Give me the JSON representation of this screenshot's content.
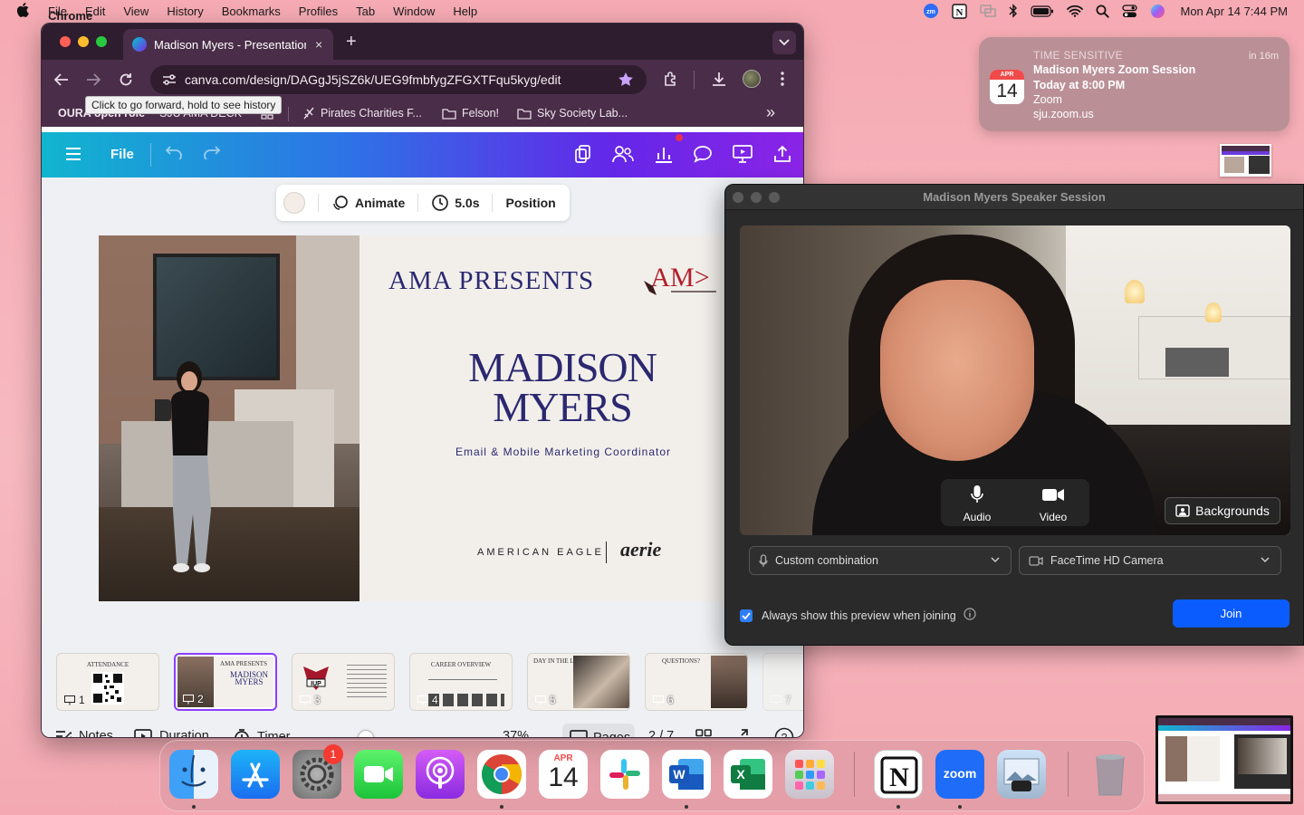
{
  "menubar": {
    "app_name": "Chrome",
    "menus": [
      "File",
      "Edit",
      "View",
      "History",
      "Bookmarks",
      "Profiles",
      "Tab",
      "Window",
      "Help"
    ],
    "clock": "Mon Apr 14  7:44 PM",
    "status_icons": [
      "zoom-icon",
      "notion-icon",
      "screen-mirror-icon",
      "bluetooth-icon",
      "battery-icon",
      "wifi-icon",
      "spotlight-search-icon",
      "control-center-icon",
      "siri-icon"
    ]
  },
  "chrome": {
    "tab_title": "Madison Myers - Presentation",
    "tab_close": "×",
    "new_tab": "+",
    "url": "canva.com/design/DAGgJ5jSZ6k/UEG9fmbfygZFGXTFqu5kyg/edit",
    "tooltip": "Click to go forward, hold to see history",
    "bookmarks": [
      "OURA open role",
      "SJU AMA DECK",
      "Pirates Charities F...",
      "Felson!",
      "Sky Society Lab..."
    ],
    "bookmarks_overflow": "»"
  },
  "canva": {
    "file_label": "File",
    "context_toolbar": {
      "animate": "Animate",
      "duration": "5.0s",
      "position": "Position"
    },
    "slide": {
      "heading": "AMA PRESENTS",
      "logo_text": "AM>",
      "name_line1": "MADISON",
      "name_line2": "MYERS",
      "role": "Email & Mobile Marketing Coordinator",
      "brand1": "AMERICAN EAGLE",
      "brand2": "aerie"
    },
    "thumbnails": [
      {
        "num": "1",
        "caption": "ATTENDANCE"
      },
      {
        "num": "2",
        "caption": "AMA PRESENTS"
      },
      {
        "num": "3",
        "caption": ""
      },
      {
        "num": "4",
        "caption": "CAREER OVERVIEW"
      },
      {
        "num": "5",
        "caption": "DAY IN THE LIFE"
      },
      {
        "num": "6",
        "caption": "QUESTIONS?"
      },
      {
        "num": "7",
        "caption": ""
      }
    ],
    "active_thumbnail": 2,
    "bottom": {
      "notes": "Notes",
      "duration": "Duration",
      "timer": "Timer",
      "zoom_level": "37%",
      "zoom_fraction": 0.37,
      "pages": "Pages",
      "page_indicator": "2 / 7",
      "help": "?"
    }
  },
  "notification": {
    "category": "TIME SENSITIVE",
    "when": "in 16m",
    "cal_month": "APR",
    "cal_day": "14",
    "title": "Madison Myers Zoom Session",
    "time": "Today at 8:00 PM",
    "app": "Zoom",
    "location": "sju.zoom.us"
  },
  "zoom_window": {
    "title": "Madison Myers Speaker Session",
    "audio_label": "Audio",
    "video_label": "Video",
    "backgrounds_label": "Backgrounds",
    "mic_select": "Custom combination",
    "camera_select": "FaceTime HD Camera",
    "always_show": "Always show this preview when joining",
    "join_label": "Join"
  },
  "dock": {
    "apps": [
      "Finder",
      "App Store",
      "System Settings",
      "FaceTime",
      "Podcasts",
      "Google Chrome",
      "Calendar",
      "Slack",
      "Microsoft Word",
      "Microsoft Excel",
      "Launchpad",
      "Notion",
      "Zoom",
      "Preview",
      "Trash"
    ],
    "settings_badge": "1",
    "calendar_month": "APR",
    "calendar_day": "14",
    "zoom_label": "zoom"
  },
  "colors": {
    "canva_gradient_start": "#11b5cf",
    "canva_gradient_end": "#8a24e6",
    "slide_navy": "#2b2870",
    "zoom_join_blue": "#0b5cff",
    "chrome_frame": "#4a2d48"
  }
}
